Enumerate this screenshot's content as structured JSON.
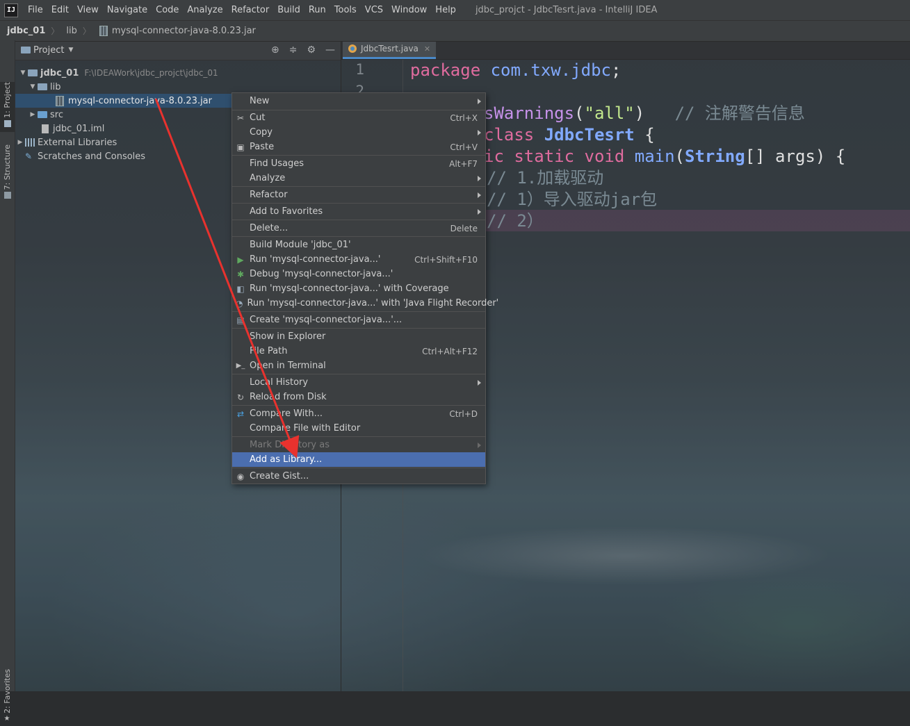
{
  "menubar": {
    "logo": "IJ",
    "items": [
      "File",
      "Edit",
      "View",
      "Navigate",
      "Code",
      "Analyze",
      "Refactor",
      "Build",
      "Run",
      "Tools",
      "VCS",
      "Window",
      "Help"
    ],
    "window_title": "jdbc_projct - JdbcTesrt.java - IntelliJ IDEA"
  },
  "breadcrumb": {
    "project": "jdbc_01",
    "folder": "lib",
    "file": "mysql-connector-java-8.0.23.jar"
  },
  "tool_stripe": {
    "project_tab": "1: Project",
    "structure_tab": "7: Structure",
    "favorites_tab": "2: Favorites"
  },
  "project_panel": {
    "title": "Project",
    "tree": {
      "root_name": "jdbc_01",
      "root_path": "F:\\IDEAWork\\jdbc_projct\\jdbc_01",
      "lib": "lib",
      "jar": "mysql-connector-java-8.0.23.jar",
      "src": "src",
      "iml": "jdbc_01.iml",
      "external_libraries": "External Libraries",
      "scratches": "Scratches and Consoles"
    }
  },
  "editor": {
    "tab_label": "JdbcTesrt.java",
    "line_numbers": [
      "1",
      "2"
    ],
    "code": {
      "l1_kw": "package",
      "l1_pkg": "com.txw.jdbc",
      "l1_end": ";",
      "l3_ann": "sWarnings",
      "l3_paren_open": "(",
      "l3_str": "\"all\"",
      "l3_paren_close": ")",
      "l3_comment": "// 注解警告信息",
      "l4_kw": "class",
      "l4_name": "JdbcTesrt",
      "l4_brace": " {",
      "l5_kw": "ic static void",
      "l5_fn": "main",
      "l5_open": "(",
      "l5_type": "String",
      "l5_rest": "[] args) {",
      "l6_comment": "// 1.加载驱动",
      "l7_comment": "// 1）导入驱动jar包",
      "l8_comment": "// 2）"
    }
  },
  "context_menu": {
    "items": [
      {
        "label": "New",
        "shortcut": "",
        "submenu": true
      },
      {
        "label": "Cut",
        "shortcut": "Ctrl+X",
        "icon": "scissors-icon"
      },
      {
        "label": "Copy",
        "shortcut": "",
        "submenu": true
      },
      {
        "label": "Paste",
        "shortcut": "Ctrl+V",
        "icon": "clipboard-icon"
      },
      {
        "label": "Find Usages",
        "shortcut": "Alt+F7"
      },
      {
        "label": "Analyze",
        "shortcut": "",
        "submenu": true
      },
      {
        "label": "Refactor",
        "shortcut": "",
        "submenu": true
      },
      {
        "label": "Add to Favorites",
        "shortcut": "",
        "submenu": true
      },
      {
        "label": "Delete...",
        "shortcut": "Delete"
      },
      {
        "label": "Build Module 'jdbc_01'",
        "shortcut": ""
      },
      {
        "label": "Run 'mysql-connector-java...'",
        "shortcut": "Ctrl+Shift+F10",
        "icon": "run-icon"
      },
      {
        "label": "Debug 'mysql-connector-java...'",
        "shortcut": "",
        "icon": "debug-icon"
      },
      {
        "label": "Run 'mysql-connector-java...' with Coverage",
        "shortcut": "",
        "icon": "coverage-icon"
      },
      {
        "label": "Run 'mysql-connector-java...' with 'Java Flight Recorder'",
        "shortcut": "",
        "icon": "flight-recorder-icon"
      },
      {
        "label": "Create 'mysql-connector-java...'...",
        "shortcut": "",
        "icon": "create-config-icon"
      },
      {
        "label": "Show in Explorer",
        "shortcut": ""
      },
      {
        "label": "File Path",
        "shortcut": "Ctrl+Alt+F12"
      },
      {
        "label": "Open in Terminal",
        "shortcut": "",
        "icon": "terminal-icon"
      },
      {
        "label": "Local History",
        "shortcut": "",
        "submenu": true
      },
      {
        "label": "Reload from Disk",
        "shortcut": "",
        "icon": "reload-icon"
      },
      {
        "label": "Compare With...",
        "shortcut": "Ctrl+D",
        "icon": "compare-icon"
      },
      {
        "label": "Compare File with Editor",
        "shortcut": ""
      },
      {
        "label": "Mark Directory as",
        "shortcut": "",
        "submenu": true,
        "disabled": true
      },
      {
        "label": "Add as Library...",
        "shortcut": "",
        "highlighted": true
      },
      {
        "label": "Create Gist...",
        "shortcut": "",
        "icon": "github-icon"
      }
    ]
  },
  "colors": {
    "menu_bg": "#3c3f41",
    "highlight": "#4b6eaf",
    "selection": "#2f4f6e",
    "annotation_arrow": "#e8322e"
  }
}
